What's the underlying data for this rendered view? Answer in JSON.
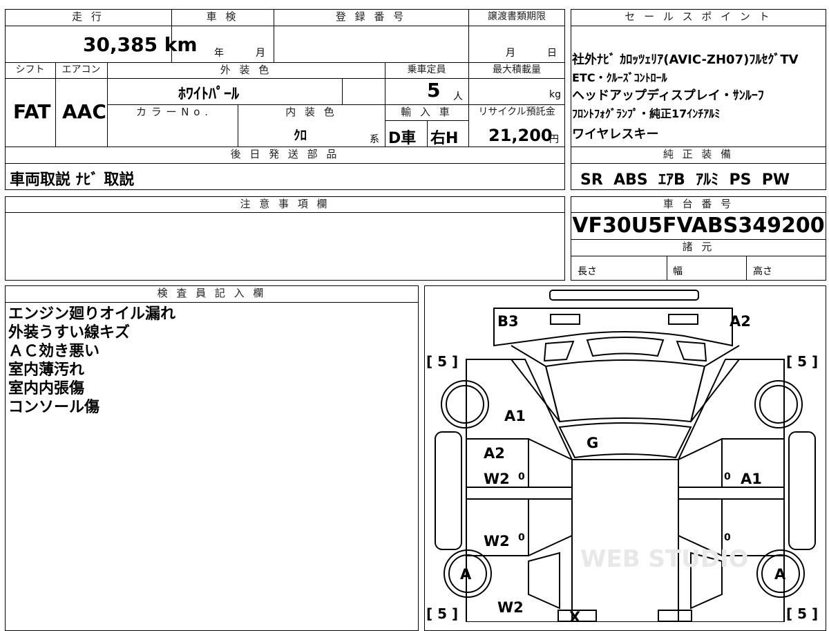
{
  "spec_sheet": {
    "mileage": {
      "header": "走 行",
      "value": "30,385 km"
    },
    "inspection": {
      "header": "車 検",
      "year_unit": "年",
      "month_unit": "月"
    },
    "registration": {
      "header": "登 録 番 号",
      "value": ""
    },
    "transfer_deadline": {
      "header": "譲渡書類期限",
      "month_unit": "月",
      "day_unit": "日"
    },
    "shift": {
      "header": "シフト",
      "value": "FAT"
    },
    "aircon": {
      "header": "エアコン",
      "value": "AAC"
    },
    "exterior_color": {
      "header": "外 装 色",
      "value": "ﾎﾜｲﾄﾊﾟｰﾙ"
    },
    "capacity": {
      "header": "乗車定員",
      "value": "5",
      "unit": "人"
    },
    "max_load": {
      "header": "最大積載量",
      "value": "",
      "unit": "kg"
    },
    "color_no": {
      "header": "カ ラ ー N o .",
      "value": ""
    },
    "interior_color": {
      "header": "内 装 色",
      "value": "ｸﾛ",
      "suffix": "系"
    },
    "import": {
      "header": "輸 入 車",
      "value1": "D車",
      "value2": "右H"
    },
    "recycle": {
      "header": "リサイクル預託金",
      "value": "21,200",
      "unit": "円"
    },
    "later_parts": {
      "header": "後 日 発 送 部 品",
      "value": "車両取説 ﾅﾋﾞ 取説"
    },
    "notes": {
      "header": "注 意 事 項 欄",
      "value": ""
    }
  },
  "sales_points": {
    "header": "セ ー ル ス ポ イ ン ト",
    "lines": [
      "社外ﾅﾋﾞ ｶﾛｯﾂｪﾘｱ(AVIC-ZH07)ﾌﾙｾｸﾞTV",
      "ETC・ｸﾙｰｽﾞｺﾝﾄﾛｰﾙ",
      "ヘッドアップディスプレイ・ｻﾝﾙｰﾌ",
      "ﾌﾛﾝﾄﾌｫｸﾞﾗﾝﾌﾟ・純正17ｲﾝﾁｱﾙﾐ",
      "ワイヤレスキー"
    ]
  },
  "standard_equipment": {
    "header": "純 正 装 備",
    "value": "SR  ABS  ｴｱB  ｱﾙﾐ  PS  PW"
  },
  "chassis": {
    "header": "車 台 番 号",
    "value": "VF30U5FVABS349200"
  },
  "specs": {
    "header": "諸 元",
    "length": "長さ",
    "width": "幅",
    "height": "高さ"
  },
  "inspector": {
    "header": "検 査 員 記 入 欄",
    "lines": [
      "エンジン廻りオイル漏れ",
      "外装うすい線キズ",
      "ＡＣ効き悪い",
      "室内薄汚れ",
      "室内内張傷",
      "コンソール傷"
    ]
  },
  "diagram": {
    "marks": {
      "b3": "B3",
      "a2_top": "A2",
      "a1_hood": "A1",
      "g_roof": "G",
      "a2_left": "A2",
      "w2_left1": "W2",
      "w2_left2": "W2",
      "w2_left3": "W2",
      "a1_right": "A1",
      "a_left_wheel": "A",
      "a_right_wheel": "A",
      "x_rear": "X",
      "zero": "0"
    },
    "tread": {
      "fl": "[ 5 ]",
      "fr": "[ 5 ]",
      "rl": "[ 5 ]",
      "rr": "[ 5 ]"
    },
    "watermark": "WEB STUDIO"
  }
}
